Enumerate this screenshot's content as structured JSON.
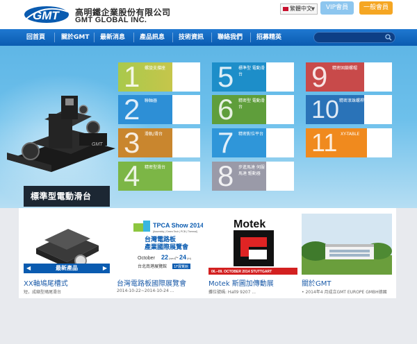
{
  "header": {
    "logo_text": "GMT",
    "brand_cn": "高明鐵企業股份有限公司",
    "brand_en": "GMT GLOBAL INC.",
    "language": "繁體中文",
    "vip_label": "VIP會員",
    "member_label": "一般會員"
  },
  "nav": {
    "items": [
      "回首頁",
      "關於GMT",
      "最新消息",
      "產品訊息",
      "技術資訊",
      "聯絡我們",
      "招募精英"
    ]
  },
  "hero": {
    "caption": "標準型電動滑台",
    "stage_logo": "GMT",
    "tiles": [
      {
        "num": "1",
        "label": "螺旋支撐座"
      },
      {
        "num": "2",
        "label": "聯軸器"
      },
      {
        "num": "3",
        "label": "滑軌/滑台"
      },
      {
        "num": "4",
        "label": "精密型滑台"
      },
      {
        "num": "5",
        "label": "標準型 電動滑台"
      },
      {
        "num": "6",
        "label": "精密型 電動滑台"
      },
      {
        "num": "7",
        "label": "精密對位平台"
      },
      {
        "num": "8",
        "label": "步進馬達 伺服馬達 驅動器"
      },
      {
        "num": "9",
        "label": "精密固鎖螺帽"
      },
      {
        "num": "10",
        "label": "精密滾珠螺桿"
      },
      {
        "num": "11",
        "label": "XY-TABLE"
      }
    ]
  },
  "section": {
    "new_products": "最新產品",
    "prev_arrow": "◀",
    "next_arrow": "▶"
  },
  "cards": [
    {
      "title": "XX軸鳩尾槽式",
      "sub": "短，成縮型鳩尾滑台"
    },
    {
      "title": "台灣電路板國際展覽會",
      "sub": "2014-10-22~2014-10-24 ..."
    },
    {
      "title": "Motek 斯圖加傳動展",
      "sub": "攤位號碼: Hall9 9207 ..."
    },
    {
      "title": "關於GMT",
      "sub": "• 2014年4 月成立GMT EUROPE GMBH德國"
    }
  ],
  "tpca": {
    "title": "TPCA Show 2014",
    "sub": "[Assembly | Green Tech | PCB | Thermal]",
    "cn1": "台灣電路板",
    "cn2": "產業國際展覽會",
    "date_a": "October",
    "day1": "22",
    "wed": "(wed)",
    "tilde": "~",
    "day2": "24",
    "fri": "(fri)",
    "venue": "台北南港展覽館",
    "floor": "1F展覽館"
  },
  "motek": {
    "title": "Motek",
    "date": "06.–09. OCTOBER 2014 STUTTGART"
  }
}
